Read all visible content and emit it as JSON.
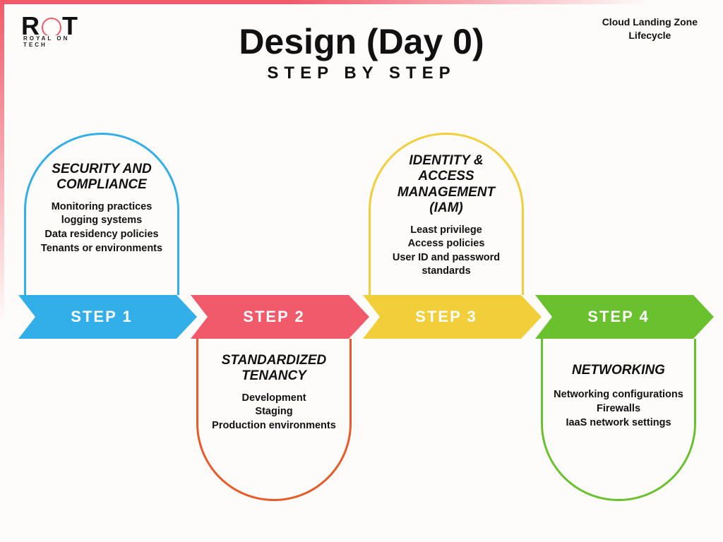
{
  "brand": {
    "name_letters": {
      "r": "R",
      "t": "T"
    },
    "tagline": "ROYAL ON TECH"
  },
  "corner": {
    "line1": "Cloud Landing Zone",
    "line2": "Lifecycle"
  },
  "title": "Design (Day 0)",
  "subtitle": "STEP BY STEP",
  "colors": {
    "step1": "#32aee8",
    "step2": "#f05a6a",
    "step2_border": "#ea5a28",
    "step3": "#f2cf3a",
    "step4": "#69c12d"
  },
  "steps": [
    {
      "label": "STEP 1",
      "heading": "SECURITY AND COMPLIANCE",
      "points": [
        "Monitoring practices",
        "logging systems",
        "Data residency policies",
        "Tenants or environments"
      ],
      "position": "up"
    },
    {
      "label": "STEP 2",
      "heading": "STANDARDIZED TENANCY",
      "points": [
        "Development",
        "Staging",
        "Production environments"
      ],
      "position": "down"
    },
    {
      "label": "STEP 3",
      "heading": "IDENTITY & ACCESS MANAGEMENT (IAM)",
      "points": [
        "Least privilege",
        "Access policies",
        "User ID and password standards"
      ],
      "position": "up"
    },
    {
      "label": "STEP 4",
      "heading": "NETWORKING",
      "points": [
        "Networking configurations",
        "Firewalls",
        "IaaS network settings"
      ],
      "position": "down"
    }
  ]
}
